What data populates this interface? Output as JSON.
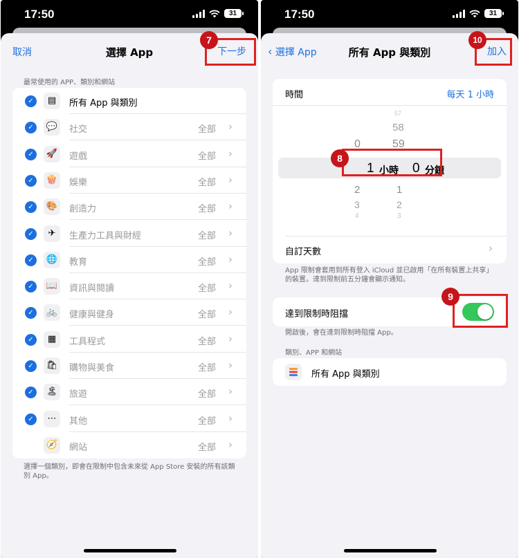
{
  "left": {
    "status": {
      "time": "17:50",
      "battery": "31"
    },
    "nav": {
      "cancel": "取消",
      "title": "選擇 App",
      "next": "下一步"
    },
    "section_label": "最常使用的 APP、類別和網站",
    "rows": [
      {
        "label": "所有 App 與類別",
        "value": "",
        "icon": "stack-icon",
        "checked": true
      },
      {
        "label": "社交",
        "value": "全部",
        "icon": "chat-bubble-icon",
        "checked": true
      },
      {
        "label": "遊戲",
        "value": "全部",
        "icon": "rocket-icon",
        "checked": true
      },
      {
        "label": "娛樂",
        "value": "全部",
        "icon": "popcorn-icon",
        "checked": true
      },
      {
        "label": "創造力",
        "value": "全部",
        "icon": "palette-icon",
        "checked": true
      },
      {
        "label": "生產力工具與財經",
        "value": "全部",
        "icon": "paper-plane-icon",
        "checked": true
      },
      {
        "label": "教育",
        "value": "全部",
        "icon": "globe-icon",
        "checked": true
      },
      {
        "label": "資訊與閱讀",
        "value": "全部",
        "icon": "book-icon",
        "checked": true
      },
      {
        "label": "健康與健身",
        "value": "全部",
        "icon": "bicycle-icon",
        "checked": true
      },
      {
        "label": "工具程式",
        "value": "全部",
        "icon": "calculator-icon",
        "checked": true
      },
      {
        "label": "購物與美食",
        "value": "全部",
        "icon": "shopping-bag-icon",
        "checked": true
      },
      {
        "label": "旅遊",
        "value": "全部",
        "icon": "island-icon",
        "checked": true
      },
      {
        "label": "其他",
        "value": "全部",
        "icon": "ellipsis-icon",
        "checked": true
      },
      {
        "label": "網站",
        "value": "全部",
        "icon": "compass-icon",
        "checked": false
      }
    ],
    "footnote": "選擇一個類別，即會在限制中包含未來從 App Store 安裝的所有該類別 App。",
    "badge": "7"
  },
  "right": {
    "status": {
      "time": "17:50",
      "battery": "31"
    },
    "nav": {
      "back": "選擇 App",
      "title": "所有 App 與類別",
      "add": "加入"
    },
    "time_label": "時間",
    "time_value": "每天 1 小時",
    "picker": {
      "hours_above": [
        "0"
      ],
      "hours_below": [
        "2",
        "3",
        "4"
      ],
      "minutes_above": [
        "57",
        "58",
        "59"
      ],
      "minutes_below": [
        "1",
        "2",
        "3"
      ],
      "hours_selected": "1",
      "hours_unit": "小時",
      "minutes_selected": "0",
      "minutes_unit": "分鐘"
    },
    "custom_days": "自訂天數",
    "note1": "App 限制會套用到所有登入 iCloud 並已啟用「在所有裝置上共享」的裝置。達到限制前五分鐘會顯示通知。",
    "block_label": "達到限制時阻擋",
    "block_enabled": true,
    "note2": "開啟後，會在達到限制時阻擋 App。",
    "section2": "類別、APP 和網站",
    "category_item": "所有 App 與類別",
    "badges": {
      "picker": "8",
      "toggle": "9",
      "add": "10"
    }
  },
  "colors": {
    "accent": "#1d6fde",
    "toggle_on": "#34c759",
    "annotation": "#e02020"
  }
}
